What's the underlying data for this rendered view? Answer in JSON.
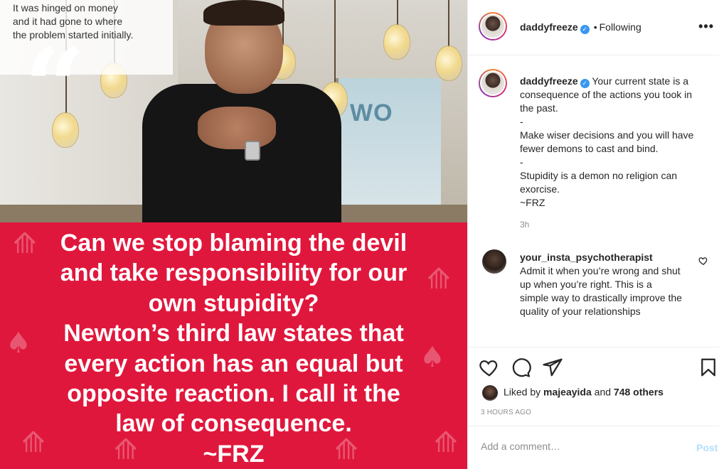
{
  "image": {
    "caption_lines": [
      "It was hinged on money",
      "and it had gone to where",
      "the problem started initially."
    ],
    "window_sign": "WO",
    "quote_lines": [
      "Can we stop blaming the devil",
      "and take responsibility for our",
      "own stupidity?",
      "Newton’s third law states that",
      "every action has an equal but",
      "opposite reaction. I call it the",
      "law of consequence.",
      "~FRZ"
    ],
    "accent_color": "#e0173c"
  },
  "header": {
    "username": "daddyfreeze",
    "separator": "•",
    "follow_status": "Following",
    "more_icon": "more-horizontal-icon"
  },
  "caption": {
    "username": "daddyfreeze",
    "lines": [
      "Your current state is a consequence of the actions you took in the past.",
      "-",
      "Make wiser decisions and you will have fewer demons to cast and bind.",
      "-",
      "Stupidity is a demon no religion can exorcise.",
      "~FRZ"
    ],
    "time": "3h"
  },
  "comment": {
    "username": "your_insta_psychotherapist",
    "text": "Admit it when you’re wrong and shut up when you’re right. This is a simple way to drastically improve the quality of your relationships"
  },
  "actions": {
    "like_icon": "heart-icon",
    "comment_icon": "comment-icon",
    "share_icon": "share-icon",
    "save_icon": "bookmark-icon"
  },
  "likes": {
    "prefix": "Liked by",
    "liker": "majeayida",
    "and": "and",
    "others": "748 others"
  },
  "post_age": "3 HOURS AGO",
  "comment_box": {
    "placeholder": "Add a comment…",
    "post_label": "Post"
  },
  "colors": {
    "link_blue": "#3897f0",
    "post_disabled": "#b2dffc",
    "muted": "#8e8e8e"
  }
}
